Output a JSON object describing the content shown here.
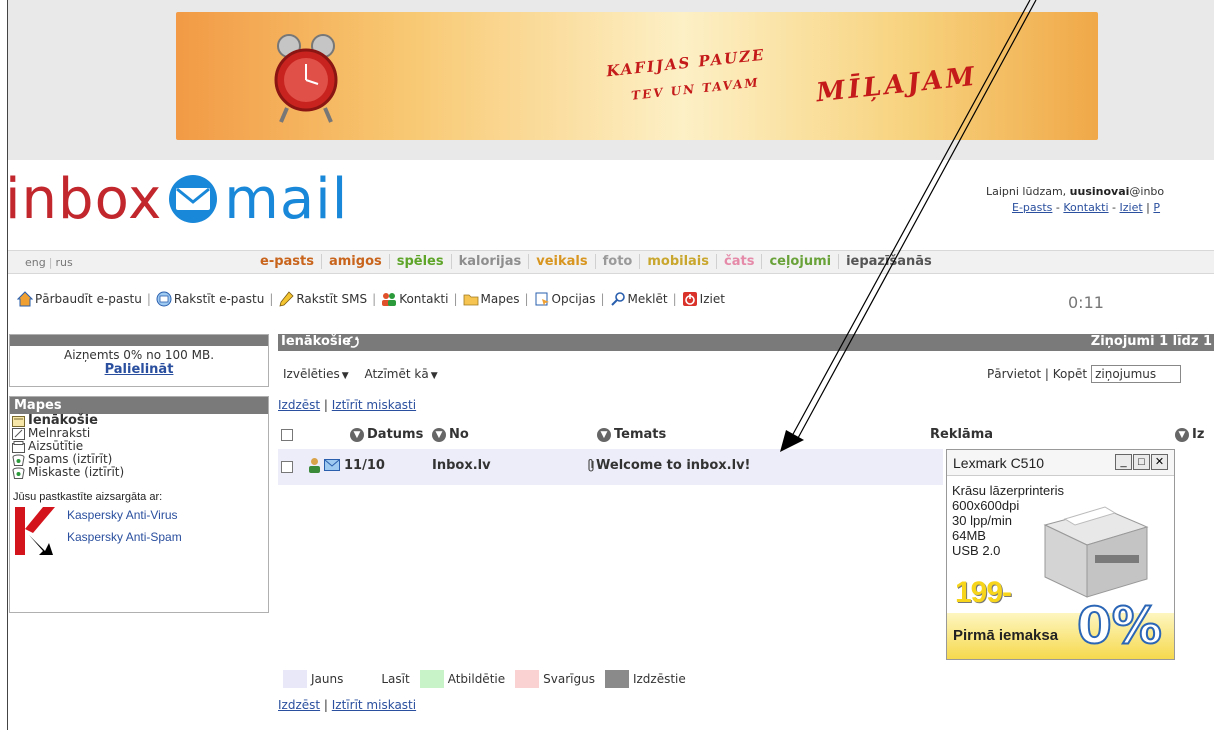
{
  "banner": {
    "line1": "KAFIJAS PAUZE",
    "line2": "TEV UN TAVAM",
    "line3": "MĪĻAJAM"
  },
  "logo": {
    "part1": "inbox",
    "part2": "mail"
  },
  "welcome": {
    "prefix": "Laipni lūdzam, ",
    "user": "uusinovai",
    "domain": "@inbo",
    "links": [
      "E-pasts",
      "Kontakti",
      "Iziet",
      "P"
    ]
  },
  "lang": [
    "eng",
    "rus"
  ],
  "nav": {
    "items": [
      {
        "label": "e-pasts",
        "color": "#c8641c"
      },
      {
        "label": "amigos",
        "color": "#c8641c"
      },
      {
        "label": "spēles",
        "color": "#5ea52a"
      },
      {
        "label": "kalorijas",
        "color": "#8e8e8e"
      },
      {
        "label": "veikals",
        "color": "#d89620"
      },
      {
        "label": "foto",
        "color": "#9a9a9a"
      },
      {
        "label": "mobilais",
        "color": "#c9a72e"
      },
      {
        "label": "čats",
        "color": "#e58aa8"
      },
      {
        "label": "ceļojumi",
        "color": "#6aa23a"
      },
      {
        "label": "iepazīšanās",
        "color": "#555555"
      }
    ]
  },
  "toolbar": {
    "check": "Pārbaudīt e-pastu",
    "write": "Rakstīt e-pastu",
    "sms": "Rakstīt SMS",
    "contacts": "Kontakti",
    "folders": "Mapes",
    "options": "Opcijas",
    "search": "Meklēt",
    "logout": "Iziet",
    "timer": "0:11"
  },
  "sidebar": {
    "quota_text": "Aizņemts 0% no 100 MB.",
    "quota_link": "Palielināt",
    "folders_title": "Mapes",
    "folders": [
      "Ienākošie",
      "Melnraksti",
      "Aizsūtītie",
      "Spams (iztīrīt)",
      "Miskaste (iztīrīt)"
    ],
    "protected_by": "Jūsu pastkastīte aizsargāta ar:",
    "kaspersky": [
      "Kaspersky Anti-Virus",
      "Kaspersky Anti-Spam"
    ]
  },
  "inbox": {
    "title": "Ienākošie",
    "counter": "Ziņojumi 1 līdz 1",
    "select": "Izvēlēties",
    "mark": "Atzīmēt kā",
    "move": "Pārvietot",
    "copy": "Kopēt",
    "move_target": "ziņojumus",
    "delete": "Izdzēst",
    "empty_trash": "Iztīrīt miskasti",
    "columns": {
      "date": "Datums",
      "from": "No",
      "subject": "Temats",
      "ad": "Reklāma",
      "size": "Iz"
    },
    "messages": [
      {
        "date": "11/10",
        "from": "Inbox.lv",
        "subject": "Welcome to inbox.lv!"
      }
    ]
  },
  "ad": {
    "title": "Lexmark C510",
    "lines": [
      "Krāsu lāzerprinteris",
      "600x600dpi",
      "30 lpp/min",
      "64MB",
      "USB 2.0"
    ],
    "price": "199-",
    "footer": "Pirmā iemaksa",
    "percent": "0%"
  },
  "legend": [
    {
      "label": "Jauns",
      "color": "#e8e8f8"
    },
    {
      "label": "Lasīt",
      "color": "#ffffff"
    },
    {
      "label": "Atbildētie",
      "color": "#c8f2c8"
    },
    {
      "label": "Svarīgus",
      "color": "#fad2d2"
    },
    {
      "label": "Izdzēstie",
      "color": "#8a8a8a"
    }
  ]
}
